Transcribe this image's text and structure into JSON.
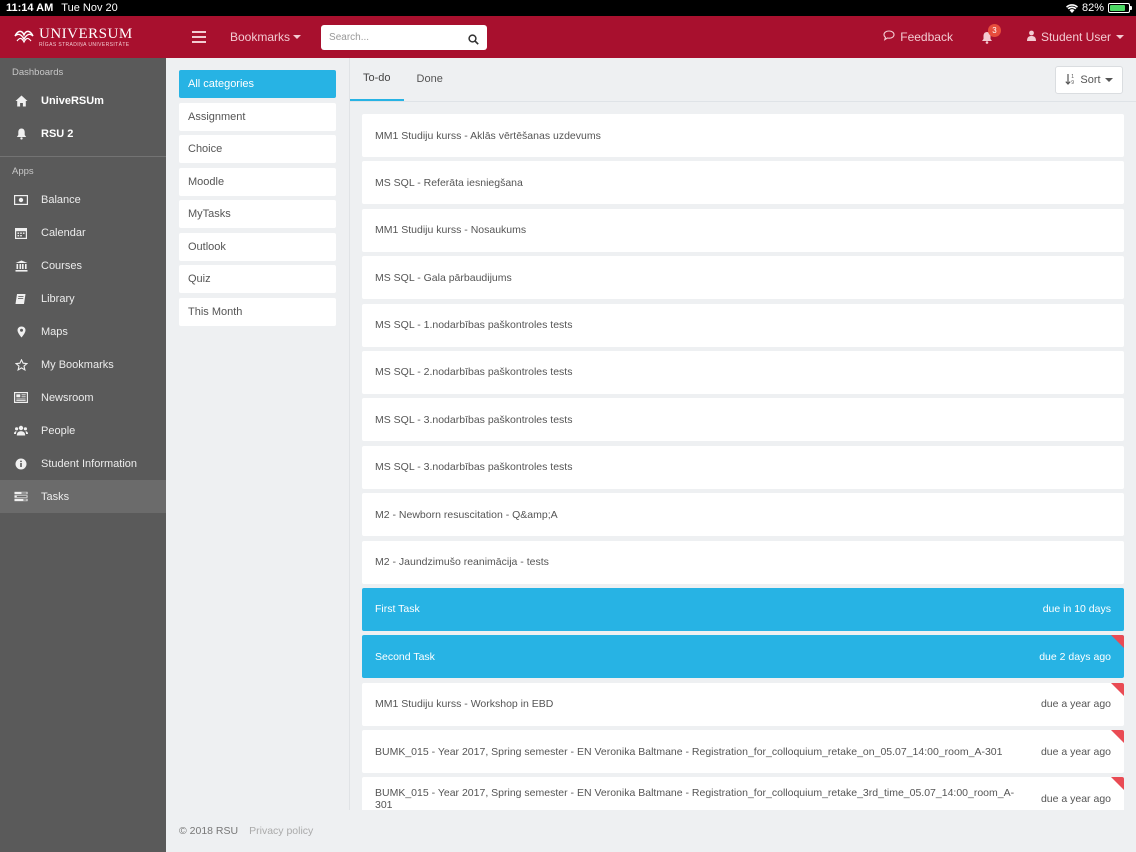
{
  "statusbar": {
    "time": "11:14 AM",
    "date": "Tue Nov 20",
    "battery": "82%",
    "battery_level": 0.82
  },
  "topnav": {
    "brand": "UNIVERSUM",
    "brand_sub": "RĪGAS STRADIŅA UNIVERSITĀTE",
    "bookmarks_label": "Bookmarks",
    "search_placeholder": "Search...",
    "feedback_label": "Feedback",
    "notification_count": "3",
    "user_label": "Student User"
  },
  "sidebar": {
    "dashboards_title": "Dashboards",
    "dashboards": [
      {
        "label": "UniveRSUm",
        "icon": "home-icon"
      },
      {
        "label": "RSU 2",
        "icon": "bell-icon"
      }
    ],
    "apps_title": "Apps",
    "apps": [
      {
        "label": "Balance",
        "icon": "money-icon"
      },
      {
        "label": "Calendar",
        "icon": "calendar-icon"
      },
      {
        "label": "Courses",
        "icon": "institution-icon"
      },
      {
        "label": "Library",
        "icon": "book-icon"
      },
      {
        "label": "Maps",
        "icon": "map-marker-icon"
      },
      {
        "label": "My Bookmarks",
        "icon": "star-icon"
      },
      {
        "label": "Newsroom",
        "icon": "newspaper-icon"
      },
      {
        "label": "People",
        "icon": "users-icon"
      },
      {
        "label": "Student Information",
        "icon": "info-circle-icon"
      },
      {
        "label": "Tasks",
        "icon": "tasks-icon",
        "active": true
      }
    ]
  },
  "categories": [
    "All categories",
    "Assignment",
    "Choice",
    "Moodle",
    "MyTasks",
    "Outlook",
    "Quiz",
    "This Month"
  ],
  "tabs": {
    "todo": "To-do",
    "done": "Done"
  },
  "sort_label": "Sort",
  "tasks": [
    {
      "title": "MM1 Studiju kurss - Aklās vērtēšanas uzdevums",
      "due": ""
    },
    {
      "title": "MS SQL - Referāta iesniegšana",
      "due": ""
    },
    {
      "title": "MM1 Studiju kurss - Nosaukums",
      "due": ""
    },
    {
      "title": "MS SQL - Gala pārbaudijums",
      "due": ""
    },
    {
      "title": "MS SQL - 1.nodarbības paškontroles tests",
      "due": ""
    },
    {
      "title": "MS SQL - 2.nodarbības paškontroles tests",
      "due": ""
    },
    {
      "title": "MS SQL - 3.nodarbības paškontroles tests",
      "due": ""
    },
    {
      "title": "MS SQL - 3.nodarbības paškontroles tests",
      "due": ""
    },
    {
      "title": "M2 - Newborn resuscitation - Q&amp;A",
      "due": ""
    },
    {
      "title": "M2 - Jaundzimušo reanimācija - tests",
      "due": ""
    },
    {
      "title": "First Task",
      "due": "due in 10 days",
      "highlight": true
    },
    {
      "title": "Second Task",
      "due": "due 2 days ago",
      "highlight": true,
      "overdue": true
    },
    {
      "title": "MM1 Studiju kurss - Workshop in EBD",
      "due": "due a year ago",
      "overdue": true
    },
    {
      "title": "BUMK_015 - Year 2017, Spring semester - EN Veronika Baltmane - Registration_for_colloquium_retake_on_05.07_14:00_room_A-301",
      "due": "due a year ago",
      "overdue": true
    },
    {
      "title": "BUMK_015 - Year 2017, Spring semester - EN Veronika Baltmane - Registration_for_colloquium_retake_3rd_time_05.07_14:00_room_A-301",
      "due": "due a year ago",
      "overdue": true
    }
  ],
  "footer": {
    "copyright": "© 2018 RSU",
    "privacy": "Privacy policy"
  },
  "colors": {
    "brand": "#a8102e",
    "accent": "#27b3e4",
    "sidebar": "#5a5a5a",
    "overdue_flag": "#e94b54"
  }
}
